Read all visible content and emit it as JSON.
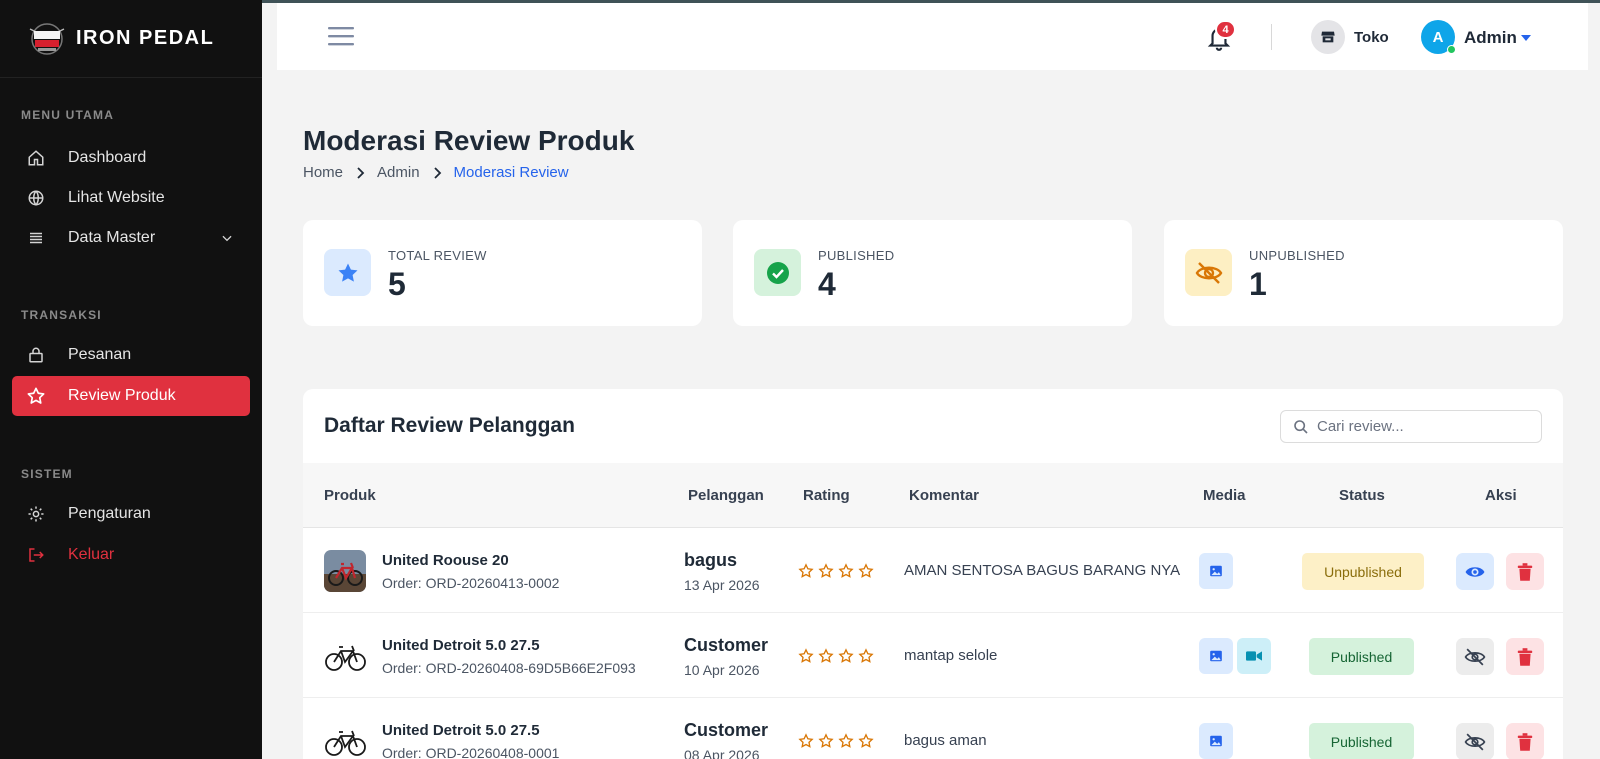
{
  "brand": {
    "name": "IRON PEDAL"
  },
  "sidebar": {
    "sections": [
      {
        "label": "MENU UTAMA"
      },
      {
        "label": "TRANSAKSI"
      },
      {
        "label": "SISTEM"
      }
    ],
    "items": [
      {
        "label": "Dashboard",
        "icon": "home-icon"
      },
      {
        "label": "Lihat Website",
        "icon": "globe-icon"
      },
      {
        "label": "Data Master",
        "icon": "list-icon"
      },
      {
        "label": "Pesanan",
        "icon": "bag-icon"
      },
      {
        "label": "Review Produk",
        "icon": "star-icon",
        "active": true
      },
      {
        "label": "Pengaturan",
        "icon": "gear-icon"
      },
      {
        "label": "Keluar",
        "icon": "logout-icon"
      }
    ]
  },
  "topbar": {
    "notif_count": "4",
    "store_label": "Toko",
    "user_initial": "A",
    "user_label": "Admin"
  },
  "page": {
    "title": "Moderasi Review Produk",
    "breadcrumb": [
      "Home",
      "Admin",
      "Moderasi Review"
    ]
  },
  "stats": [
    {
      "label": "TOTAL REVIEW",
      "value": "5",
      "icon": "star-icon",
      "color": "#3b82f6"
    },
    {
      "label": "PUBLISHED",
      "value": "4",
      "icon": "check-circle-icon",
      "color": "#16a34a"
    },
    {
      "label": "UNPUBLISHED",
      "value": "1",
      "icon": "eye-slash-icon",
      "color": "#d97706"
    }
  ],
  "table": {
    "title": "Daftar Review Pelanggan",
    "search_placeholder": "Cari review...",
    "columns": [
      "Produk",
      "Pelanggan",
      "Rating",
      "Komentar",
      "Media",
      "Status",
      "Aksi"
    ],
    "rows": [
      {
        "product": "United Roouse 20",
        "order": "Order: ORD-20260413-0002",
        "customer": "bagus",
        "date": "13 Apr 2026",
        "rating": 0,
        "comment": "AMAN SENTOSA BAGUS BARANG NYA",
        "status": "Unpublished"
      },
      {
        "product": "United Detroit 5.0 27.5",
        "order": "Order: ORD-20260408-69D5B66E2F093",
        "customer": "Customer",
        "date": "10 Apr 2026",
        "rating": 0,
        "comment": "mantap selole",
        "status": "Published"
      },
      {
        "product": "United Detroit 5.0 27.5",
        "order": "Order: ORD-20260408-0001",
        "customer": "Customer",
        "date": "08 Apr 2026",
        "rating": 0,
        "comment": "bagus aman",
        "status": "Published"
      }
    ]
  },
  "colors": {
    "accent": "#e0313f",
    "link": "#2563eb",
    "sidebar_bg": "#111111"
  }
}
